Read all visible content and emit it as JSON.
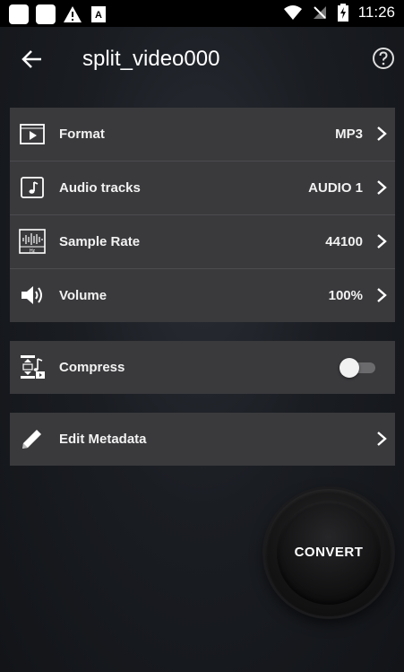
{
  "status_bar": {
    "time": "11:26"
  },
  "app_bar": {
    "title": "split_video000",
    "back_icon": "arrow-left-icon",
    "help_icon": "help-circle-icon"
  },
  "settings": [
    {
      "id": "format",
      "icon": "video-format-icon",
      "label": "Format",
      "value": "MP3"
    },
    {
      "id": "audio-tracks",
      "icon": "music-note-icon",
      "label": "Audio tracks",
      "value": "AUDIO 1"
    },
    {
      "id": "sample-rate",
      "icon": "waveform-hz-icon",
      "label": "Sample Rate",
      "value": "44100"
    },
    {
      "id": "volume",
      "icon": "speaker-icon",
      "label": "Volume",
      "value": "100%"
    }
  ],
  "compress": {
    "icon": "compress-icon",
    "label": "Compress",
    "enabled": false
  },
  "metadata": {
    "icon": "pencil-icon",
    "label": "Edit Metadata"
  },
  "convert": {
    "label": "CONVERT"
  },
  "colors": {
    "card": "#3a3a3d",
    "statusbar": "#000000",
    "text": "#ffffff"
  }
}
